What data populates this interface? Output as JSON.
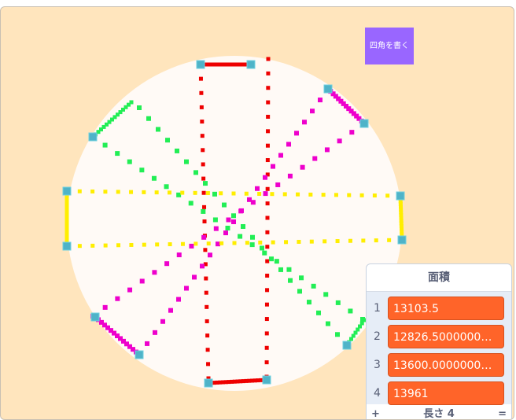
{
  "stage": {
    "background": "#ffe5bd",
    "circle_color": "#fffaf6",
    "draw_button_label": "四角を書く",
    "draw_button_color": "#9966ff"
  },
  "drawing": {
    "colors": {
      "red": "#ee0000",
      "magenta": "#ee00cc",
      "green": "#22ee55",
      "yellow": "#ffee00",
      "marker_fill": "#4fb3c8"
    }
  },
  "list_monitor": {
    "title": "面積",
    "items": [
      {
        "index": "1",
        "value": "13103.5"
      },
      {
        "index": "2",
        "value": "12826.500000000002"
      },
      {
        "index": "3",
        "value": "13600.000000000002"
      },
      {
        "index": "4",
        "value": "13961"
      }
    ],
    "add_label": "+",
    "length_label": "長さ 4",
    "resize_label": "="
  }
}
